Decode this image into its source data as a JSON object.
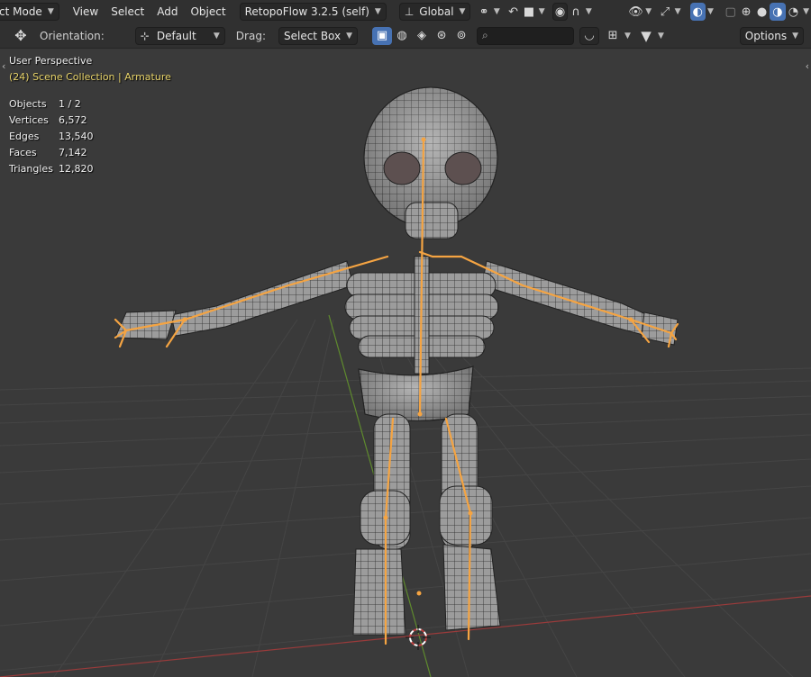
{
  "header": {
    "mode": "ct Mode",
    "menus": [
      "View",
      "Select",
      "Add",
      "Object"
    ],
    "addon": "RetopoFlow 3.2.5 (self)",
    "transform_orientation": "Global"
  },
  "tool_header": {
    "orientation_label": "Orientation:",
    "orientation_value": "Default",
    "drag_label": "Drag:",
    "drag_value": "Select Box",
    "search_placeholder": "",
    "options_label": "Options"
  },
  "viewport": {
    "view_name": "User Perspective",
    "collection": "(24) Scene Collection | Armature",
    "stats": [
      {
        "label": "Objects",
        "value": "1 / 2"
      },
      {
        "label": "Vertices",
        "value": "6,572"
      },
      {
        "label": "Edges",
        "value": "13,540"
      },
      {
        "label": "Faces",
        "value": "7,142"
      },
      {
        "label": "Triangles",
        "value": "12,820"
      }
    ]
  },
  "colors": {
    "header_bg": "#303030",
    "viewport_bg": "#3a3a3a",
    "accent_blue": "#4772b3",
    "bone_orange": "#f5a442",
    "collection_text": "#e8d46a",
    "x_axis": "#9a3b3b",
    "y_axis": "#5f8a2e"
  }
}
